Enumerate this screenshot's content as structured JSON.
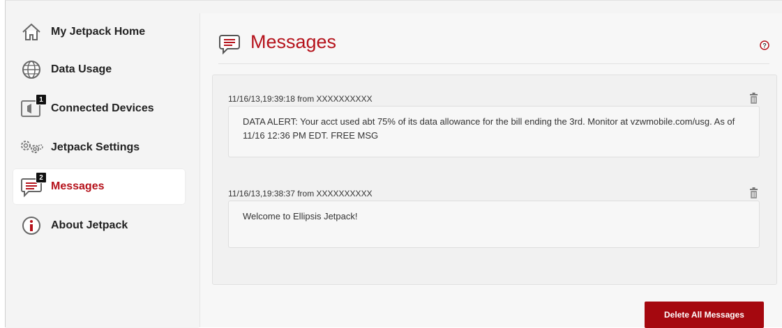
{
  "sidebar": {
    "items": [
      {
        "label": "My Jetpack Home",
        "icon": "home-icon"
      },
      {
        "label": "Data Usage",
        "icon": "globe-icon"
      },
      {
        "label": "Connected Devices",
        "icon": "device-icon",
        "badge": "1"
      },
      {
        "label": "Jetpack Settings",
        "icon": "gears-icon"
      },
      {
        "label": "Messages",
        "icon": "message-icon",
        "badge": "2",
        "active": true
      },
      {
        "label": "About Jetpack",
        "icon": "info-icon"
      }
    ]
  },
  "page": {
    "title": "Messages",
    "help_icon": "help-icon"
  },
  "messages": [
    {
      "header": "11/16/13,19:39:18 from XXXXXXXXXX",
      "body": "DATA ALERT: Your acct used abt 75% of its data allowance for the bill ending the 3rd. Monitor at vzwmobile.com/usg. As of 11/16 12:36 PM EDT. FREE MSG"
    },
    {
      "header": "11/16/13,19:38:37 from XXXXXXXXXX",
      "body": "Welcome to Ellipsis Jetpack!"
    }
  ],
  "actions": {
    "delete_all_label": "Delete All Messages"
  },
  "colors": {
    "accent": "#b5121b",
    "button": "#a5080f"
  }
}
